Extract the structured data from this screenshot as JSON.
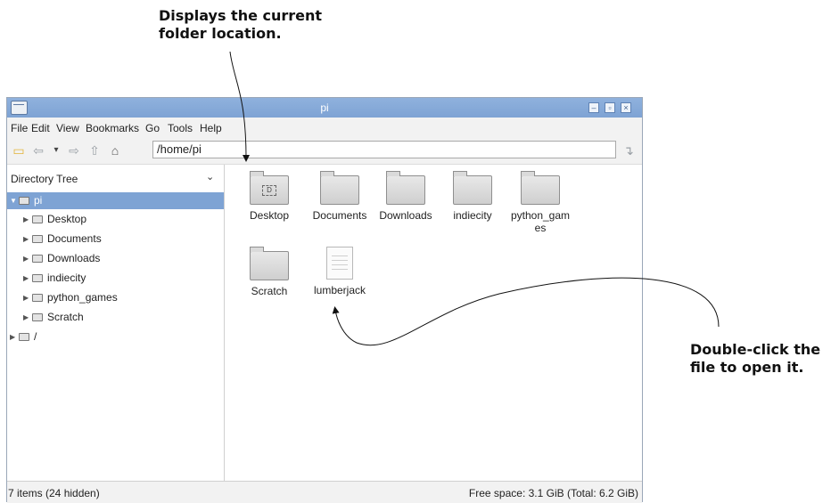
{
  "callouts": {
    "top": [
      "Displays the current",
      "folder location."
    ],
    "right": [
      "Double-click the",
      "file to open it."
    ]
  },
  "window": {
    "title": "pi",
    "menu": [
      "File",
      "Edit",
      "View",
      "Bookmarks",
      "Go",
      "Tools",
      "Help"
    ],
    "path": "/home/pi"
  },
  "sidebar": {
    "header": "Directory Tree",
    "tree": [
      {
        "label": "pi",
        "level": 0,
        "expanded": true,
        "selected": true,
        "icon": "home-folder-icon"
      },
      {
        "label": "Desktop",
        "level": 1,
        "icon": "desktop-folder-icon"
      },
      {
        "label": "Documents",
        "level": 1,
        "icon": "folder-icon"
      },
      {
        "label": "Downloads",
        "level": 1,
        "icon": "folder-icon"
      },
      {
        "label": "indiecity",
        "level": 1,
        "icon": "folder-icon"
      },
      {
        "label": "python_games",
        "level": 1,
        "icon": "folder-icon"
      },
      {
        "label": "Scratch",
        "level": 1,
        "icon": "folder-icon"
      },
      {
        "label": "/",
        "level": 0,
        "icon": "folder-icon"
      }
    ]
  },
  "files": {
    "row1": [
      {
        "label": "Desktop",
        "type": "desktop-folder"
      },
      {
        "label": "Documents",
        "type": "folder"
      },
      {
        "label": "Downloads",
        "type": "folder"
      },
      {
        "label": "indiecity",
        "type": "folder"
      },
      {
        "label": "python_gam\nes",
        "type": "folder"
      }
    ],
    "row2": [
      {
        "label": "Scratch",
        "type": "folder"
      },
      {
        "label": "lumberjack",
        "type": "file"
      }
    ]
  },
  "status": {
    "left": "7 items (24 hidden)",
    "right": "Free space: 3.1 GiB (Total: 6.2 GiB)"
  },
  "colors": {
    "titlebar": "#7ea3d4",
    "selection": "#7ea3d4"
  }
}
